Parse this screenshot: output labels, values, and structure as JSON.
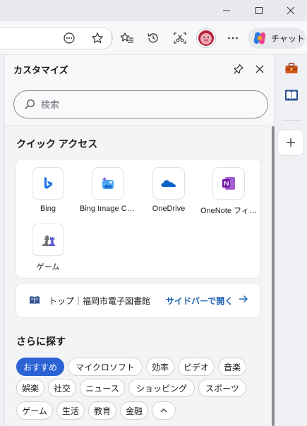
{
  "toolbar": {
    "copilot_label": "チャット"
  },
  "panel": {
    "title": "カスタマイズ",
    "search": {
      "placeholder": "検索"
    }
  },
  "quick_access": {
    "title": "クイック アクセス",
    "items": [
      {
        "label": "Bing",
        "icon": "bing-icon"
      },
      {
        "label": "Bing Image Creator",
        "icon": "image-creator-icon"
      },
      {
        "label": "OneDrive",
        "icon": "onedrive-icon"
      },
      {
        "label": "OneNote フィード",
        "icon": "onenote-icon"
      },
      {
        "label": "ゲーム",
        "icon": "chess-icon"
      }
    ]
  },
  "book": {
    "text": "トップ｜福岡市電子図書館",
    "open_label": "サイドバーで開く"
  },
  "explore": {
    "title": "さらに探す",
    "chips": [
      {
        "label": "おすすめ",
        "active": true
      },
      {
        "label": "マイクロソフト"
      },
      {
        "label": "効率"
      },
      {
        "label": "ビデオ"
      },
      {
        "label": "音楽"
      },
      {
        "label": "娯楽"
      },
      {
        "label": "社交"
      },
      {
        "label": "ニュース"
      },
      {
        "label": "ショッピング"
      },
      {
        "label": "スポーツ"
      },
      {
        "label": "ゲーム"
      },
      {
        "label": "生活"
      },
      {
        "label": "教育"
      },
      {
        "label": "金融"
      }
    ]
  },
  "colors": {
    "accent": "#2b63d4",
    "link": "#1a5fb4"
  }
}
